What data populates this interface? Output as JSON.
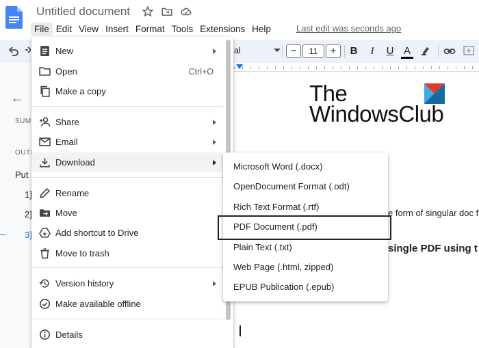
{
  "app": {
    "doc_title": "Untitled document",
    "last_edit": "Last edit was seconds ago"
  },
  "menubar": [
    "File",
    "Edit",
    "View",
    "Insert",
    "Format",
    "Tools",
    "Extensions",
    "Help"
  ],
  "toolbar": {
    "font_name": "al",
    "font_size": "11",
    "minus": "−",
    "plus": "+",
    "bold": "B",
    "italic": "I",
    "underline": "U",
    "text_color_glyph": "A",
    "text_color": "#000000"
  },
  "outline": {
    "summary": "SUM",
    "outline": "OUTL",
    "put": "Put",
    "headings": [
      "1]",
      "2]",
      "3]"
    ]
  },
  "file_menu": {
    "items": [
      {
        "label": "New",
        "icon": "new-doc-icon",
        "submenu": true
      },
      {
        "label": "Open",
        "icon": "folder-icon",
        "shortcut": "Ctrl+O"
      },
      {
        "label": "Make a copy",
        "icon": "copy-icon"
      },
      {
        "label": "Share",
        "icon": "person-add-icon",
        "submenu": true
      },
      {
        "label": "Email",
        "icon": "email-icon",
        "submenu": true
      },
      {
        "label": "Download",
        "icon": "download-icon",
        "submenu": true
      },
      {
        "label": "Rename",
        "icon": "pencil-icon"
      },
      {
        "label": "Move",
        "icon": "move-folder-icon"
      },
      {
        "label": "Add shortcut to Drive",
        "icon": "drive-shortcut-icon"
      },
      {
        "label": "Move to trash",
        "icon": "trash-icon"
      },
      {
        "label": "Version history",
        "icon": "history-icon",
        "submenu": true
      },
      {
        "label": "Make available offline",
        "icon": "offline-icon"
      },
      {
        "label": "Details",
        "icon": "info-icon"
      }
    ]
  },
  "download_menu": {
    "items": [
      "Microsoft Word (.docx)",
      "OpenDocument Format (.odt)",
      "Rich Text Format (.rtf)",
      "PDF Document (.pdf)",
      "Plain Text (.txt)",
      "Web Page (.html, zipped)",
      "EPUB Publication (.epub)"
    ],
    "highlighted": "PDF Document (.pdf)"
  },
  "document": {
    "logo_line1": "The",
    "logo_line2": "WindowsClub",
    "text_fragment": "e form of singular doc f",
    "heading_fragment": "single PDF using t"
  },
  "colors": {
    "accent": "#1a73e8",
    "docs_blue": "#4285f4",
    "menu_hover": "#f1f3f4"
  }
}
